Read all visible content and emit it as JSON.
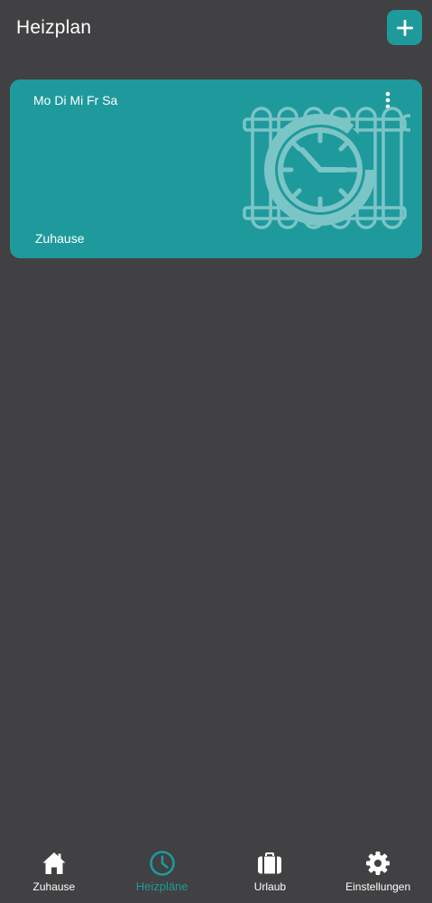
{
  "header": {
    "title": "Heizplan",
    "add_icon": "plus-icon"
  },
  "schedules": [
    {
      "days": "Mo Di Mi Fr Sa",
      "name": "Zuhause",
      "menu_icon": "more-vertical-icon",
      "illustration": "radiator-clock-icon"
    }
  ],
  "bottom_nav": {
    "items": [
      {
        "label": "Zuhause",
        "icon": "home-icon",
        "active": false
      },
      {
        "label": "Heizpläne",
        "icon": "clock-icon",
        "active": true
      },
      {
        "label": "Urlaub",
        "icon": "suitcase-icon",
        "active": false
      },
      {
        "label": "Einstellungen",
        "icon": "gear-icon",
        "active": false
      }
    ]
  },
  "colors": {
    "background": "#414042",
    "accent": "#1f9a9c",
    "text": "#ffffff"
  }
}
